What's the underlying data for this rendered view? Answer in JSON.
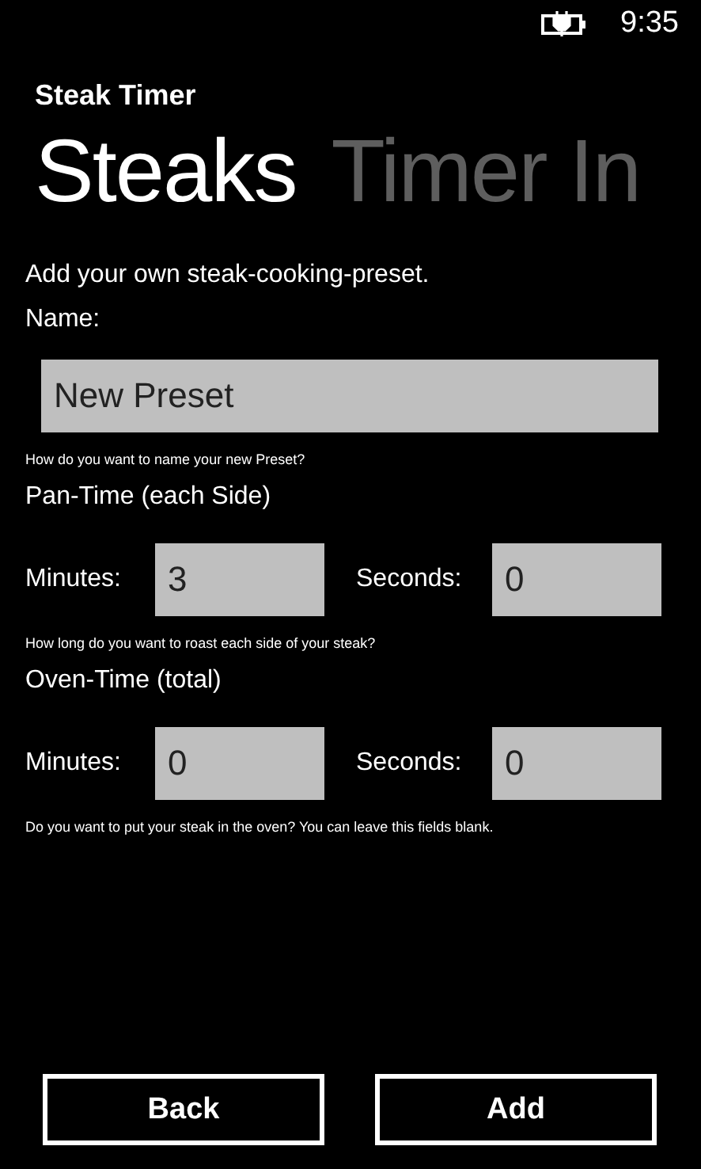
{
  "status_bar": {
    "time": "9:35"
  },
  "app_title": "Steak Timer",
  "pivots": [
    {
      "label": "Steaks",
      "selected": true
    },
    {
      "label": "Timer In",
      "selected": false
    }
  ],
  "intro": "Add your own steak-cooking-preset.",
  "name_field": {
    "label": "Name:",
    "value": "New Preset",
    "hint": "How do you want to name your new Preset?"
  },
  "sections": [
    {
      "title": "Pan-Time (each Side)",
      "fields": [
        {
          "label": "Minutes:",
          "value": "3"
        },
        {
          "label": "Seconds:",
          "value": "0"
        }
      ],
      "hint": "How long do you want to roast each side of your steak?"
    },
    {
      "title": "Oven-Time (total)",
      "fields": [
        {
          "label": "Minutes:",
          "value": "0"
        },
        {
          "label": "Seconds:",
          "value": "0"
        }
      ],
      "hint": "Do you want to put your steak in the oven? You can leave this fields blank."
    }
  ],
  "buttons": [
    "Back",
    "Add"
  ]
}
